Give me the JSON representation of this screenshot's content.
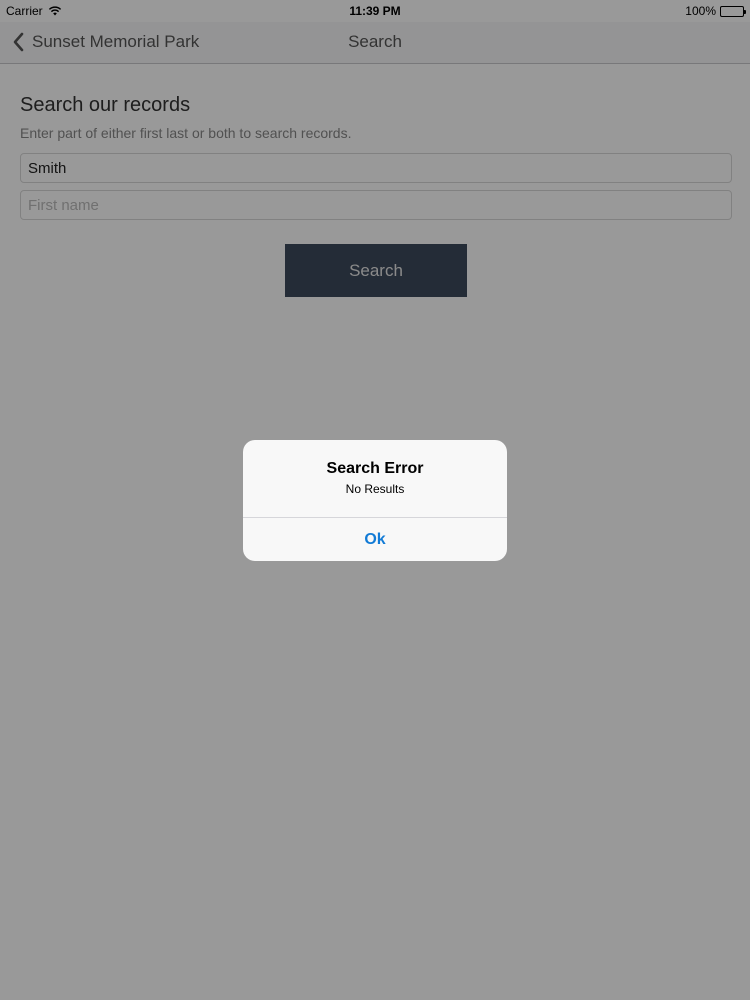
{
  "status_bar": {
    "carrier": "Carrier",
    "time": "11:39 PM",
    "battery": "100%"
  },
  "nav": {
    "back_label": "Sunset Memorial Park",
    "title": "Search"
  },
  "search": {
    "heading": "Search our records",
    "subheading": "Enter part of either first last or both to search records.",
    "last_name_value": "Smith",
    "first_name_placeholder": "First name",
    "button_label": "Search"
  },
  "alert": {
    "title": "Search Error",
    "message": "No Results",
    "ok_label": "Ok"
  },
  "colors": {
    "accent": "#127bd6",
    "button_bg": "#3d4a5c"
  }
}
